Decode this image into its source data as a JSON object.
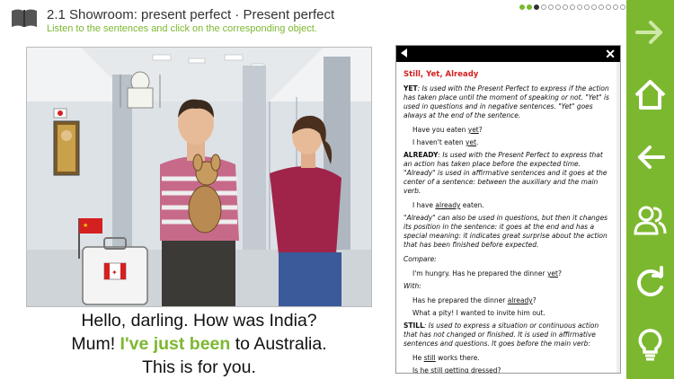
{
  "header": {
    "title": "2.1 Showroom: present perfect · Present perfect",
    "subtitle": "Listen to the sentences and click on the corresponding object.",
    "progress": {
      "total": 18,
      "current": 3
    }
  },
  "caption": {
    "line1": "Hello, darling. How was India?",
    "line2_pre": "Mum! ",
    "line2_highlight": "I've just been",
    "line2_post": " to Australia.",
    "line3": "This is for you."
  },
  "panel": {
    "heading": "Still, Yet, Already",
    "yet_term": "YET",
    "yet_def": ": Is used with the Present Perfect to express if the action has taken place until the moment of speaking or not. \"Yet\" is used in questions and in negative sentences. \"Yet\" goes always at the end of the sentence.",
    "yet_ex1_pre": "Have you eaten ",
    "yet_ex1_u": "yet",
    "yet_ex1_post": "?",
    "yet_ex2_pre": "I haven't eaten ",
    "yet_ex2_u": "yet",
    "yet_ex2_post": ".",
    "already_term": "ALREADY",
    "already_def": ": Is used with the Present Perfect to express that an action has taken place before the expected time. \"Already\" is used in affirmative sentences and it goes at the center of a sentence: between the auxiliary and the main verb.",
    "already_ex1_pre": "I have ",
    "already_ex1_u": "already",
    "already_ex1_post": " eaten.",
    "already_note": "\"Already\" can also be used in questions, but then it changes its position in the sentence: it goes at the end and has a special meaning: it indicates great surprise about the action that has been finished before expected.",
    "compare_label": "Compare:",
    "compare_ex_pre": "I'm hungry. Has he prepared the dinner ",
    "compare_ex_u": "yet",
    "compare_ex_post": "?",
    "with_label": "With:",
    "with_ex1_pre": "Has he prepared the dinner ",
    "with_ex1_u": "already",
    "with_ex1_post": "?",
    "with_ex2": "What a pity! I wanted to invite him out.",
    "still_term": "STILL",
    "still_def": ": Is used to express a situation or continuous action that has not changed or finished. It is used in affirmative sentences and questions. It goes before the main verb:",
    "still_ex1_pre": "He ",
    "still_ex1_u": "still",
    "still_ex1_post": " works there.",
    "still_ex2_pre": "Is he ",
    "still_ex2_u": "still",
    "still_ex2_post": " getting dressed?"
  },
  "sidebar": {
    "buttons": [
      "arrow-right-icon",
      "home-icon",
      "arrow-left-icon",
      "users-icon",
      "refresh-icon",
      "lightbulb-icon"
    ]
  },
  "colors": {
    "accent": "#7cb82f",
    "heading_red": "#d42020"
  }
}
